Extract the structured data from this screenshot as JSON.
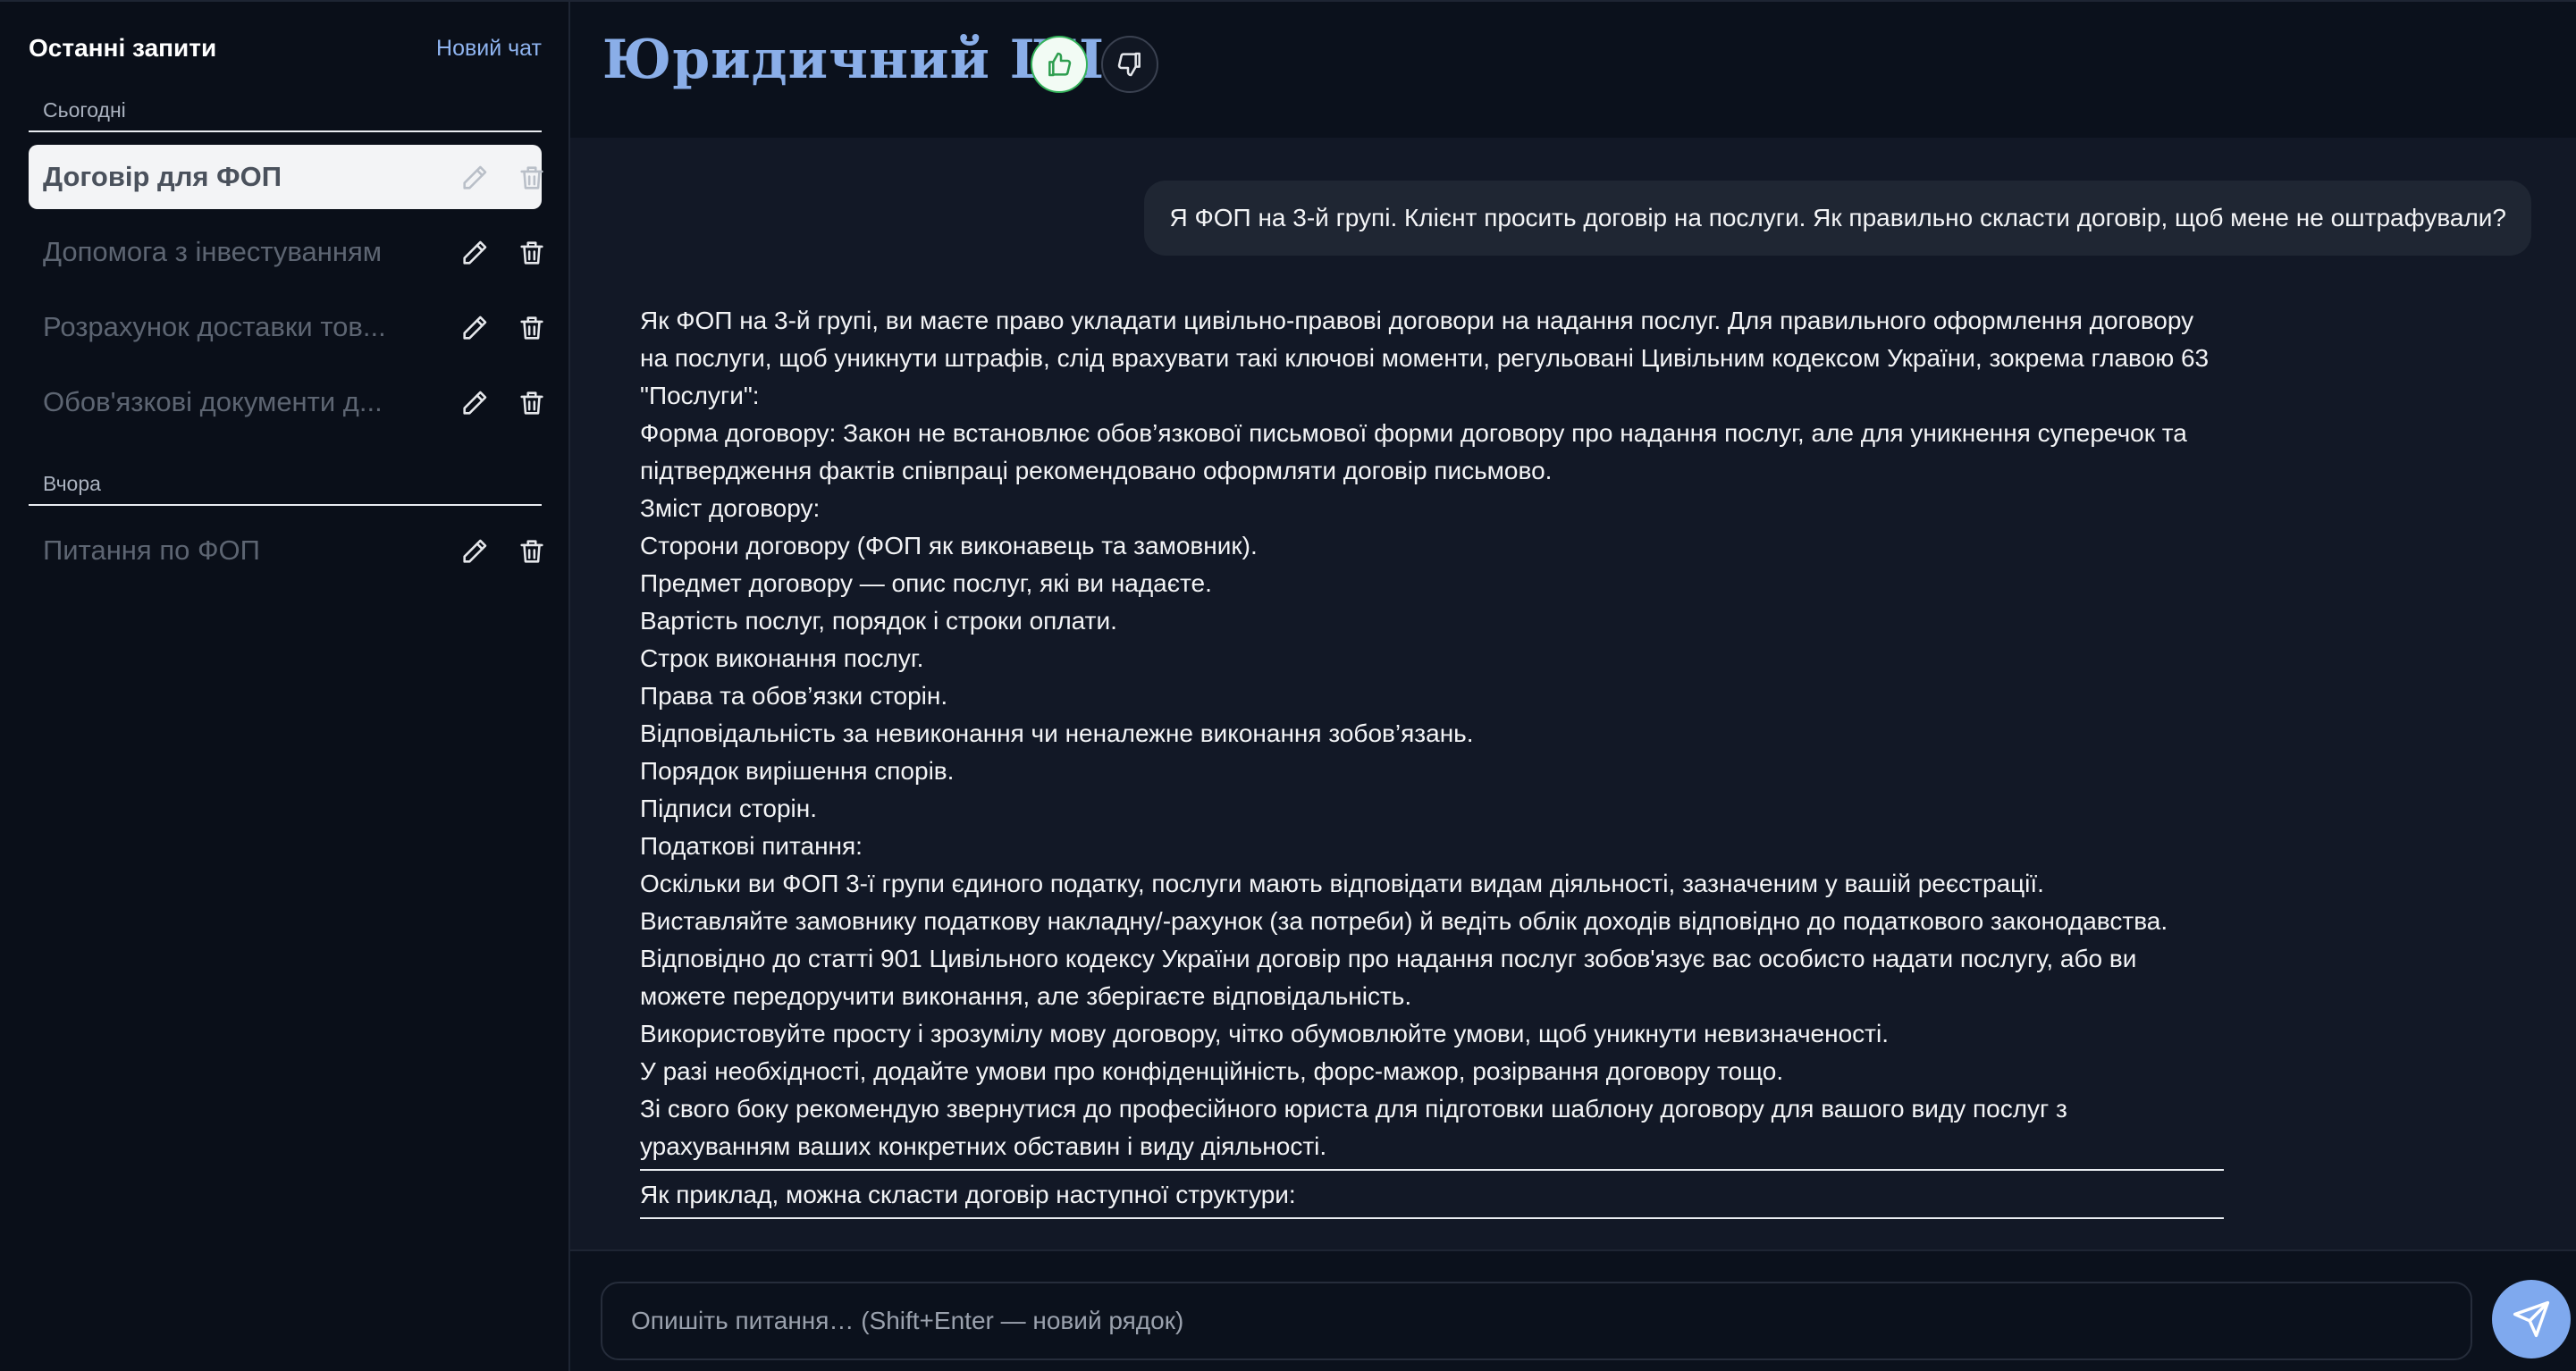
{
  "sidebar": {
    "title": "Останні запити",
    "new_chat": "Новий чат",
    "groups": [
      {
        "label": "Сьогодні",
        "items": [
          {
            "label": "Договір для ФОП",
            "active": true
          },
          {
            "label": "Допомога з інвестуванням",
            "active": false
          },
          {
            "label": "Розрахунок доставки тов...",
            "active": false
          },
          {
            "label": "Обов'язкові документи д...",
            "active": false
          }
        ]
      },
      {
        "label": "Вчора",
        "items": [
          {
            "label": "Питання по ФОП",
            "active": false
          }
        ]
      }
    ]
  },
  "header": {
    "title": "Юридичний ШІ",
    "thumbs_up_icon": "thumbs-up-icon",
    "thumbs_down_icon": "thumbs-down-icon"
  },
  "conversation": {
    "user_message": "Я ФОП на 3-й групі. Клієнт просить договір на послуги. Як правильно скласти договір, щоб мене не оштрафували?",
    "assistant_paragraphs": [
      "Як ФОП на 3-й групі, ви маєте право укладати цивільно-правові договори на надання послуг. Для правильного оформлення договору на послуги, щоб уникнути штрафів, слід врахувати такі ключові моменти, регульовані Цивільним кодексом України, зокрема главою 63 \"Послуги\":",
      "Форма договору: Закон не встановлює обов’язкової письмової форми договору про надання послуг, але для уникнення суперечок та підтвердження фактів співпраці рекомендовано оформляти договір письмово.",
      "Зміст договору:",
      "Сторони договору (ФОП як виконавець та замовник).",
      "Предмет договору — опис послуг, які ви надаєте.",
      "Вартість послуг, порядок і строки оплати.",
      "Строк виконання послуг.",
      "Права та обов’язки сторін.",
      "Відповідальність за невиконання чи неналежне виконання зобов’язань.",
      "Порядок вирішення спорів.",
      "Підписи сторін.",
      "Податкові питання:",
      "Оскільки ви ФОП 3-ї групи єдиного податку, послуги мають відповідати видам діяльності, зазначеним у вашій реєстрації.",
      "Виставляйте замовнику податкову накладну/-рахунок (за потреби) й ведіть облік доходів відповідно до податкового законодавства.",
      "Відповідно до статті 901 Цивільного кодексу України договір про надання послуг зобов'язує вас особисто надати послугу, або ви можете передоручити виконання, але зберігаєте відповідальність.",
      "Використовуйте просту і зрозумілу мову договору, чітко обумовлюйте умови, щоб уникнути невизначеності.",
      "У разі необхідності, додайте умови про конфіденційність, форс-мажор, розірвання договору тощо.",
      "Зі свого боку рекомендую звернутися до професійного юриста для підготовки шаблону договору для вашого виду послуг з урахуванням ваших конкретних обставин і виду діяльності."
    ],
    "assistant_after_rule": "Як приклад, можна скласти договір наступної структури:"
  },
  "composer": {
    "placeholder": "Опишіть питання… (Shift+Enter — новий рядок)",
    "value": "",
    "send_icon": "send-icon"
  },
  "colors": {
    "accent": "#8aaee8",
    "sidebar_bg": "#0a0f19",
    "chat_bg": "#121826",
    "active_item_bg": "#f3f4f6",
    "send_button": "#7fa9ee",
    "thumbs_up_border": "#34b25a"
  }
}
